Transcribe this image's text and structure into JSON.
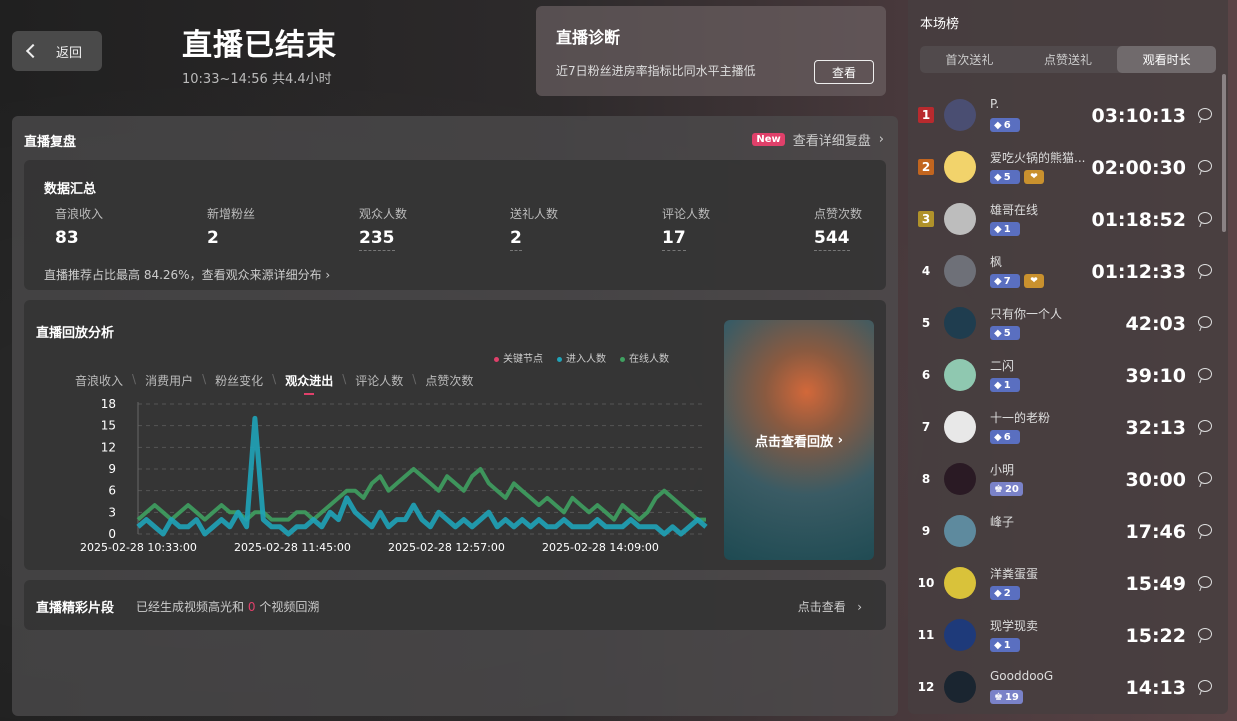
{
  "header": {
    "back_label": "返回",
    "title": "直播已结束",
    "time_range": "10:33~14:56 共4.4小时"
  },
  "diagnosis": {
    "title": "直播诊断",
    "desc": "近7日粉丝进房率指标比同水平主播低",
    "button": "查看"
  },
  "review": {
    "title": "直播复盘",
    "new_badge": "New",
    "detail_link": "查看详细复盘",
    "summary": {
      "title": "数据汇总",
      "stats": [
        {
          "label": "音浪收入",
          "value": "83"
        },
        {
          "label": "新增粉丝",
          "value": "2"
        },
        {
          "label": "观众人数",
          "value": "235"
        },
        {
          "label": "送礼人数",
          "value": "2"
        },
        {
          "label": "评论人数",
          "value": "17"
        },
        {
          "label": "点赞次数",
          "value": "544"
        }
      ],
      "foot": "直播推荐占比最高 84.26%，查看观众来源详细分布"
    },
    "analysis": {
      "title": "直播回放分析",
      "tabs": [
        "音浪收入",
        "消费用户",
        "粉丝变化",
        "观众进出",
        "评论人数",
        "点赞次数"
      ],
      "active_tab": "观众进出",
      "replay_label": "点击查看回放"
    },
    "highlights": {
      "title": "直播精彩片段",
      "desc_a": "已经生成视频高光和",
      "desc_count": "0",
      "desc_b": "个视频回溯",
      "link": "点击查看"
    }
  },
  "chart_data": {
    "type": "line",
    "legend_position": "top-right",
    "grid": true,
    "ylim": [
      0,
      18
    ],
    "yticks": [
      0,
      3,
      6,
      9,
      12,
      15,
      18
    ],
    "xticks": [
      "2025-02-28 10:33:00",
      "2025-02-28 11:45:00",
      "2025-02-28 12:57:00",
      "2025-02-28 14:09:00"
    ],
    "series": [
      {
        "name": "关键节点",
        "color": "#e0406a",
        "values": []
      },
      {
        "name": "进入人数",
        "color": "#1fa3b8",
        "values": [
          1,
          2,
          1,
          0,
          2,
          1,
          1,
          2,
          0,
          1,
          2,
          1,
          3,
          1,
          16,
          2,
          1,
          1,
          0,
          1,
          1,
          2,
          1,
          3,
          2,
          5,
          3,
          2,
          1,
          3,
          1,
          2,
          2,
          4,
          2,
          1,
          3,
          2,
          1,
          2,
          1,
          2,
          3,
          1,
          2,
          1,
          2,
          1,
          2,
          1,
          1,
          2,
          1,
          1,
          1,
          2,
          1,
          1,
          1,
          2,
          1,
          1,
          1,
          0,
          1,
          0,
          1,
          2,
          1
        ]
      },
      {
        "name": "在线人数",
        "color": "#3fa060",
        "values": [
          2,
          3,
          4,
          3,
          2,
          3,
          4,
          3,
          2,
          3,
          4,
          3,
          3,
          2,
          3,
          3,
          2,
          2,
          2,
          3,
          3,
          2,
          3,
          4,
          5,
          6,
          6,
          5,
          7,
          8,
          6,
          7,
          8,
          9,
          8,
          7,
          6,
          8,
          7,
          6,
          8,
          9,
          7,
          6,
          5,
          7,
          6,
          5,
          4,
          5,
          4,
          3,
          5,
          4,
          3,
          4,
          3,
          2,
          4,
          3,
          2,
          3,
          5,
          6,
          5,
          4,
          3,
          2,
          2
        ]
      }
    ]
  },
  "ranking": {
    "title": "本场榜",
    "tabs": [
      "首次送礼",
      "点赞送礼",
      "观看时长"
    ],
    "active_tab": "观看时长",
    "rows": [
      {
        "rank": "1",
        "name": "P.",
        "level": "6",
        "fan": false,
        "medal": false,
        "duration": "03:10:13"
      },
      {
        "rank": "2",
        "name": "爱吃火锅的熊猫...",
        "level": "5",
        "fan": false,
        "medal": true,
        "duration": "02:00:30"
      },
      {
        "rank": "3",
        "name": "雄哥在线",
        "level": "1",
        "fan": false,
        "medal": false,
        "duration": "01:18:52"
      },
      {
        "rank": "4",
        "name": "枫",
        "level": "7",
        "fan": false,
        "medal": true,
        "duration": "01:12:33"
      },
      {
        "rank": "5",
        "name": "只有你一个人",
        "level": "5",
        "fan": false,
        "medal": false,
        "duration": "42:03"
      },
      {
        "rank": "6",
        "name": "二闪",
        "level": "1",
        "fan": false,
        "medal": false,
        "duration": "39:10"
      },
      {
        "rank": "7",
        "name": "十一的老粉",
        "level": "6",
        "fan": false,
        "medal": false,
        "duration": "32:13"
      },
      {
        "rank": "8",
        "name": "小明",
        "level": "20",
        "fan": true,
        "medal": false,
        "duration": "30:00"
      },
      {
        "rank": "9",
        "name": "峰子",
        "level": "",
        "fan": false,
        "medal": false,
        "duration": "17:46"
      },
      {
        "rank": "10",
        "name": "洋粪蛋蛋",
        "level": "2",
        "fan": false,
        "medal": false,
        "duration": "15:49"
      },
      {
        "rank": "11",
        "name": "现学现卖",
        "level": "1",
        "fan": false,
        "medal": false,
        "duration": "15:22"
      },
      {
        "rank": "12",
        "name": "GooddooG",
        "level": "19",
        "fan": true,
        "medal": false,
        "duration": "14:13"
      }
    ],
    "avatar_colors": [
      "#4a4e72",
      "#f2d36b",
      "#bdbdbd",
      "#6e7078",
      "#1f3d4f",
      "#8fc8b0",
      "#e8e8e8",
      "#2a1a24",
      "#5e8a9e",
      "#d9c23a",
      "#1e3a7a",
      "#1a2530"
    ]
  },
  "colors": {
    "accent": "#e0406a",
    "enter": "#1fa3b8",
    "online": "#3fa060"
  }
}
